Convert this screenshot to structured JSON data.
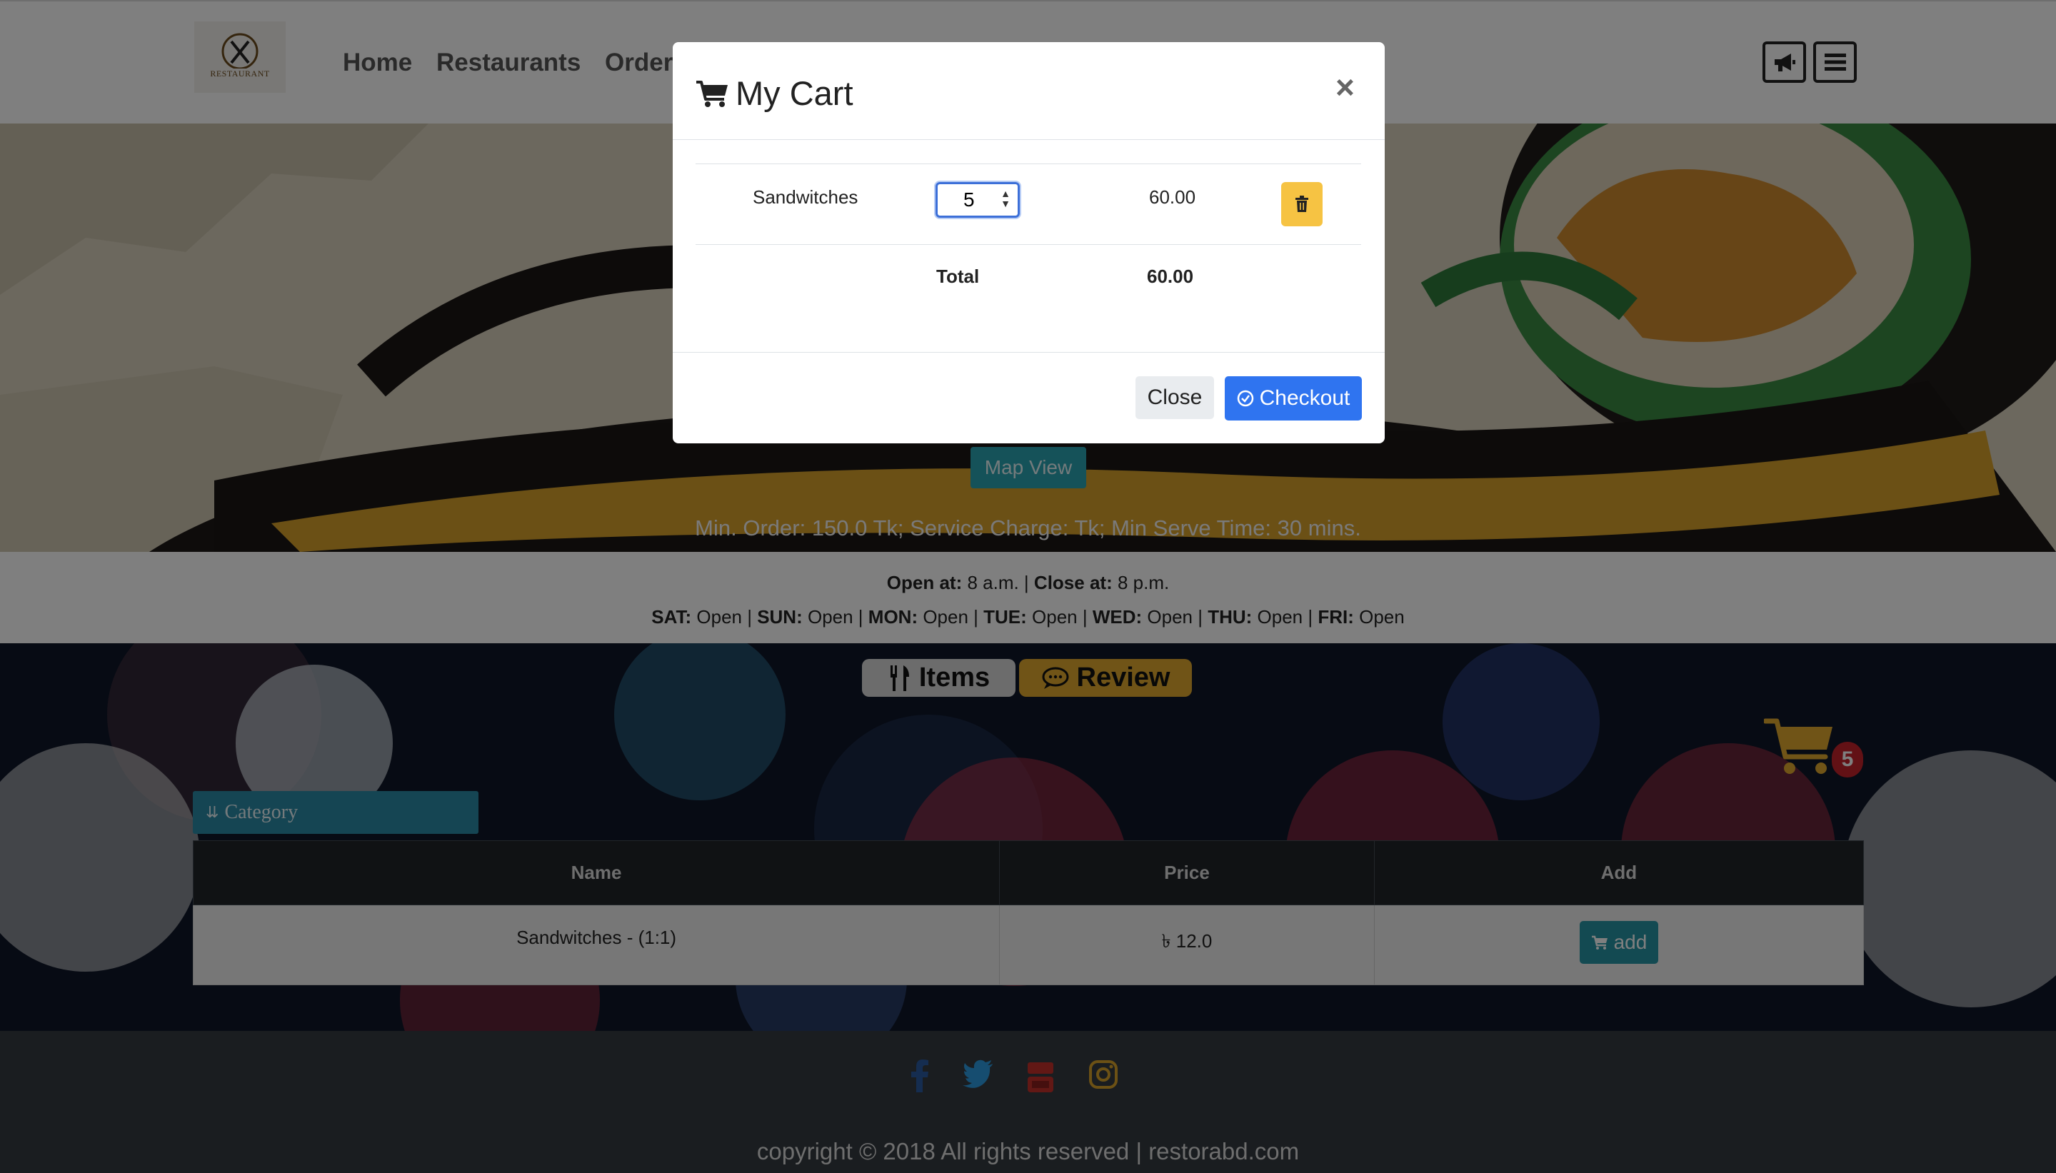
{
  "navbar": {
    "logo_text": "RESTAURANT",
    "links": [
      "Home",
      "Restaurants",
      "Order"
    ],
    "icons": [
      "megaphone-icon",
      "hamburger-menu-icon"
    ]
  },
  "hero": {
    "map_button": "Map View",
    "info": "Min. Order: 150.0 Tk; Service Charge: Tk; Min Serve Time: 30 mins."
  },
  "hours": {
    "open_label": "Open at:",
    "open_value": " 8 a.m. | ",
    "close_label": "Close at:",
    "close_value": " 8 p.m.",
    "days": [
      {
        "day": "SAT:",
        "status": " Open",
        "sep": " | "
      },
      {
        "day": "SUN:",
        "status": " Open",
        "sep": " | "
      },
      {
        "day": "MON:",
        "status": " Open",
        "sep": " | "
      },
      {
        "day": "TUE:",
        "status": " Open",
        "sep": " | "
      },
      {
        "day": "WED:",
        "status": " Open",
        "sep": " | "
      },
      {
        "day": "THU:",
        "status": " Open",
        "sep": " | "
      },
      {
        "day": "FRI:",
        "status": " Open",
        "sep": ""
      }
    ]
  },
  "tabs": {
    "items_label": "Items",
    "review_label": "Review",
    "items_color": "#d8d8d8",
    "review_color": "#e0a82e"
  },
  "cart_float": {
    "count": "5",
    "color": "#e0a82e"
  },
  "category": {
    "label": "Category"
  },
  "table": {
    "headers": [
      "Name",
      "Price",
      "Add"
    ],
    "rows": [
      {
        "name": "Sandwitches - (1:1)",
        "price": "৳ 12.0",
        "add_label": "add"
      }
    ]
  },
  "footer": {
    "social_icons": [
      "facebook-icon",
      "twitter-icon",
      "youtube-icon",
      "instagram-icon"
    ],
    "copyright": "copyright © 2018 All rights reserved  |  restorabd.com"
  },
  "modal": {
    "title": "My Cart",
    "close_symbol": "×",
    "item": {
      "name": "Sandwitches",
      "quantity": "5",
      "price": "60.00"
    },
    "total_label": "Total",
    "total_value": "60.00",
    "close_button": "Close",
    "checkout_button": "Checkout",
    "accent_color": "#2f74f0"
  }
}
